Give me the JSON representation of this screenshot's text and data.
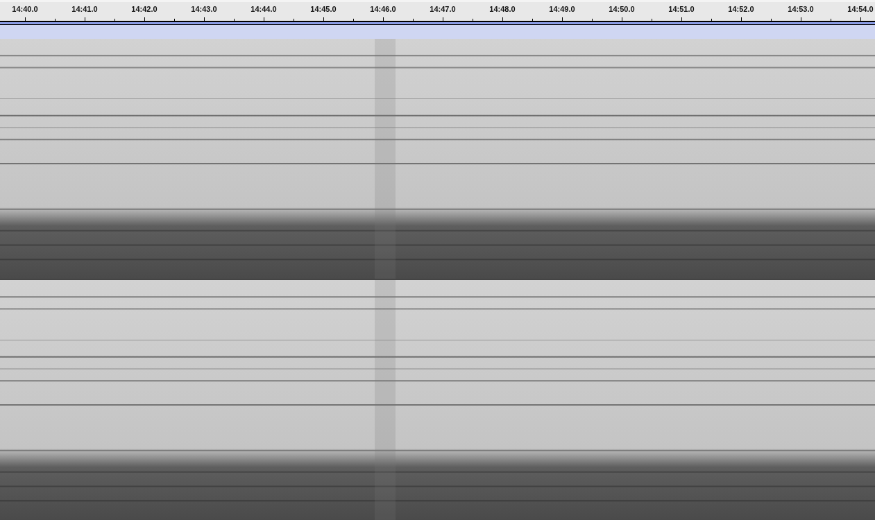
{
  "ruler": {
    "labels": [
      "14:40.0",
      "14:41.0",
      "14:42.0",
      "14:43.0",
      "14:44.0",
      "14:45.0",
      "14:46.0",
      "14:47.0",
      "14:48.0",
      "14:49.0",
      "14:50.0",
      "14:51.0",
      "14:52.0",
      "14:53.0",
      "14:54.0"
    ]
  },
  "tracks": [
    {
      "kind": "spectrogram"
    },
    {
      "kind": "spectrogram"
    }
  ]
}
